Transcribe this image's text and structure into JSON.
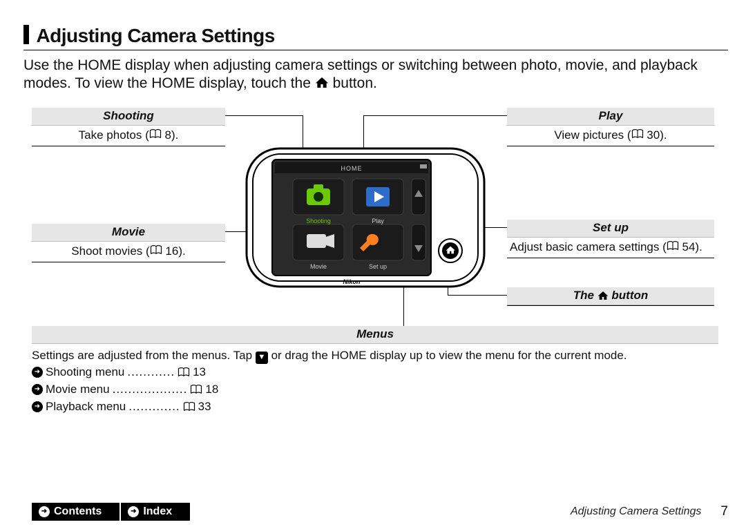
{
  "heading": "Adjusting Camera Settings",
  "intro_part1": "Use the HOME display when adjusting camera settings or switching between photo, movie, and playback modes. To view the HOME display, touch the ",
  "intro_part2": " button.",
  "callouts": {
    "shooting": {
      "title": "Shooting",
      "body": "Take photos (",
      "page": "8",
      "after": ")."
    },
    "movie": {
      "title": "Movie",
      "body": "Shoot movies (",
      "page": "16",
      "after": ")."
    },
    "play": {
      "title": "Play",
      "body": "View pictures (",
      "page": "30",
      "after": ")."
    },
    "setup": {
      "title": "Set up",
      "body": "Adjust basic camera settings (",
      "page": "54",
      "after": ")."
    },
    "homebtn": {
      "title_pre": "The ",
      "title_post": " button"
    }
  },
  "device": {
    "home_label": "HOME",
    "items": {
      "shooting": "Shooting",
      "play": "Play",
      "movie": "Movie",
      "setup": "Set up"
    },
    "brand": "Nikon"
  },
  "menus": {
    "title": "Menus",
    "intro_pre": "Settings are adjusted from the menus. Tap ",
    "intro_post": " or drag the HOME display up to view the menu for the current mode.",
    "items": [
      {
        "label": "Shooting menu",
        "dots": "............",
        "page": "13"
      },
      {
        "label": "Movie menu",
        "dots": "...................",
        "page": "18"
      },
      {
        "label": "Playback menu",
        "dots": ".............",
        "page": "33"
      }
    ]
  },
  "footer": {
    "contents": "Contents",
    "index": "Index",
    "section": "Adjusting Camera Settings",
    "page": "7"
  }
}
